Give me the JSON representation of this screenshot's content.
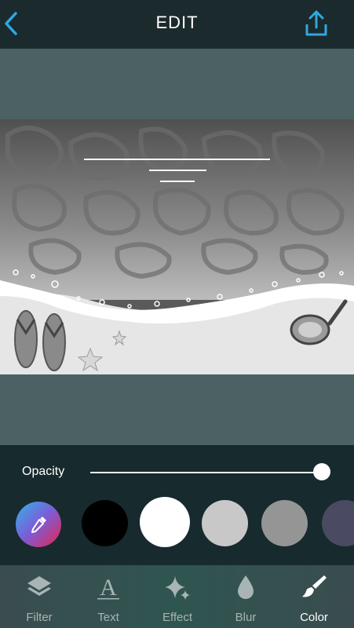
{
  "header": {
    "title": "EDIT",
    "back_icon": "chevron-left-icon",
    "share_icon": "share-upload-icon"
  },
  "colors": {
    "accent": "#2fa8e0",
    "header_bg": "#1b2a2d",
    "canvas_bg": "#4c6164",
    "panel_bg": "#172a2d"
  },
  "opacity": {
    "label": "Opacity",
    "value": 1.0
  },
  "swatches": [
    {
      "name": "eyedropper",
      "icon": "eyedropper-icon"
    },
    {
      "name": "black",
      "color": "#000000"
    },
    {
      "name": "white",
      "color": "#ffffff",
      "selected": true
    },
    {
      "name": "light-gray",
      "color": "#c8c8c8"
    },
    {
      "name": "gray",
      "color": "#959595"
    },
    {
      "name": "slate-purple",
      "color": "#4a4a62"
    }
  ],
  "tabs": [
    {
      "label": "Filter",
      "icon": "layers-icon"
    },
    {
      "label": "Text",
      "icon": "text-a-icon"
    },
    {
      "label": "Effect",
      "icon": "sparkle-icon"
    },
    {
      "label": "Blur",
      "icon": "droplet-icon"
    },
    {
      "label": "Color",
      "icon": "paintbrush-icon",
      "active": true
    }
  ]
}
